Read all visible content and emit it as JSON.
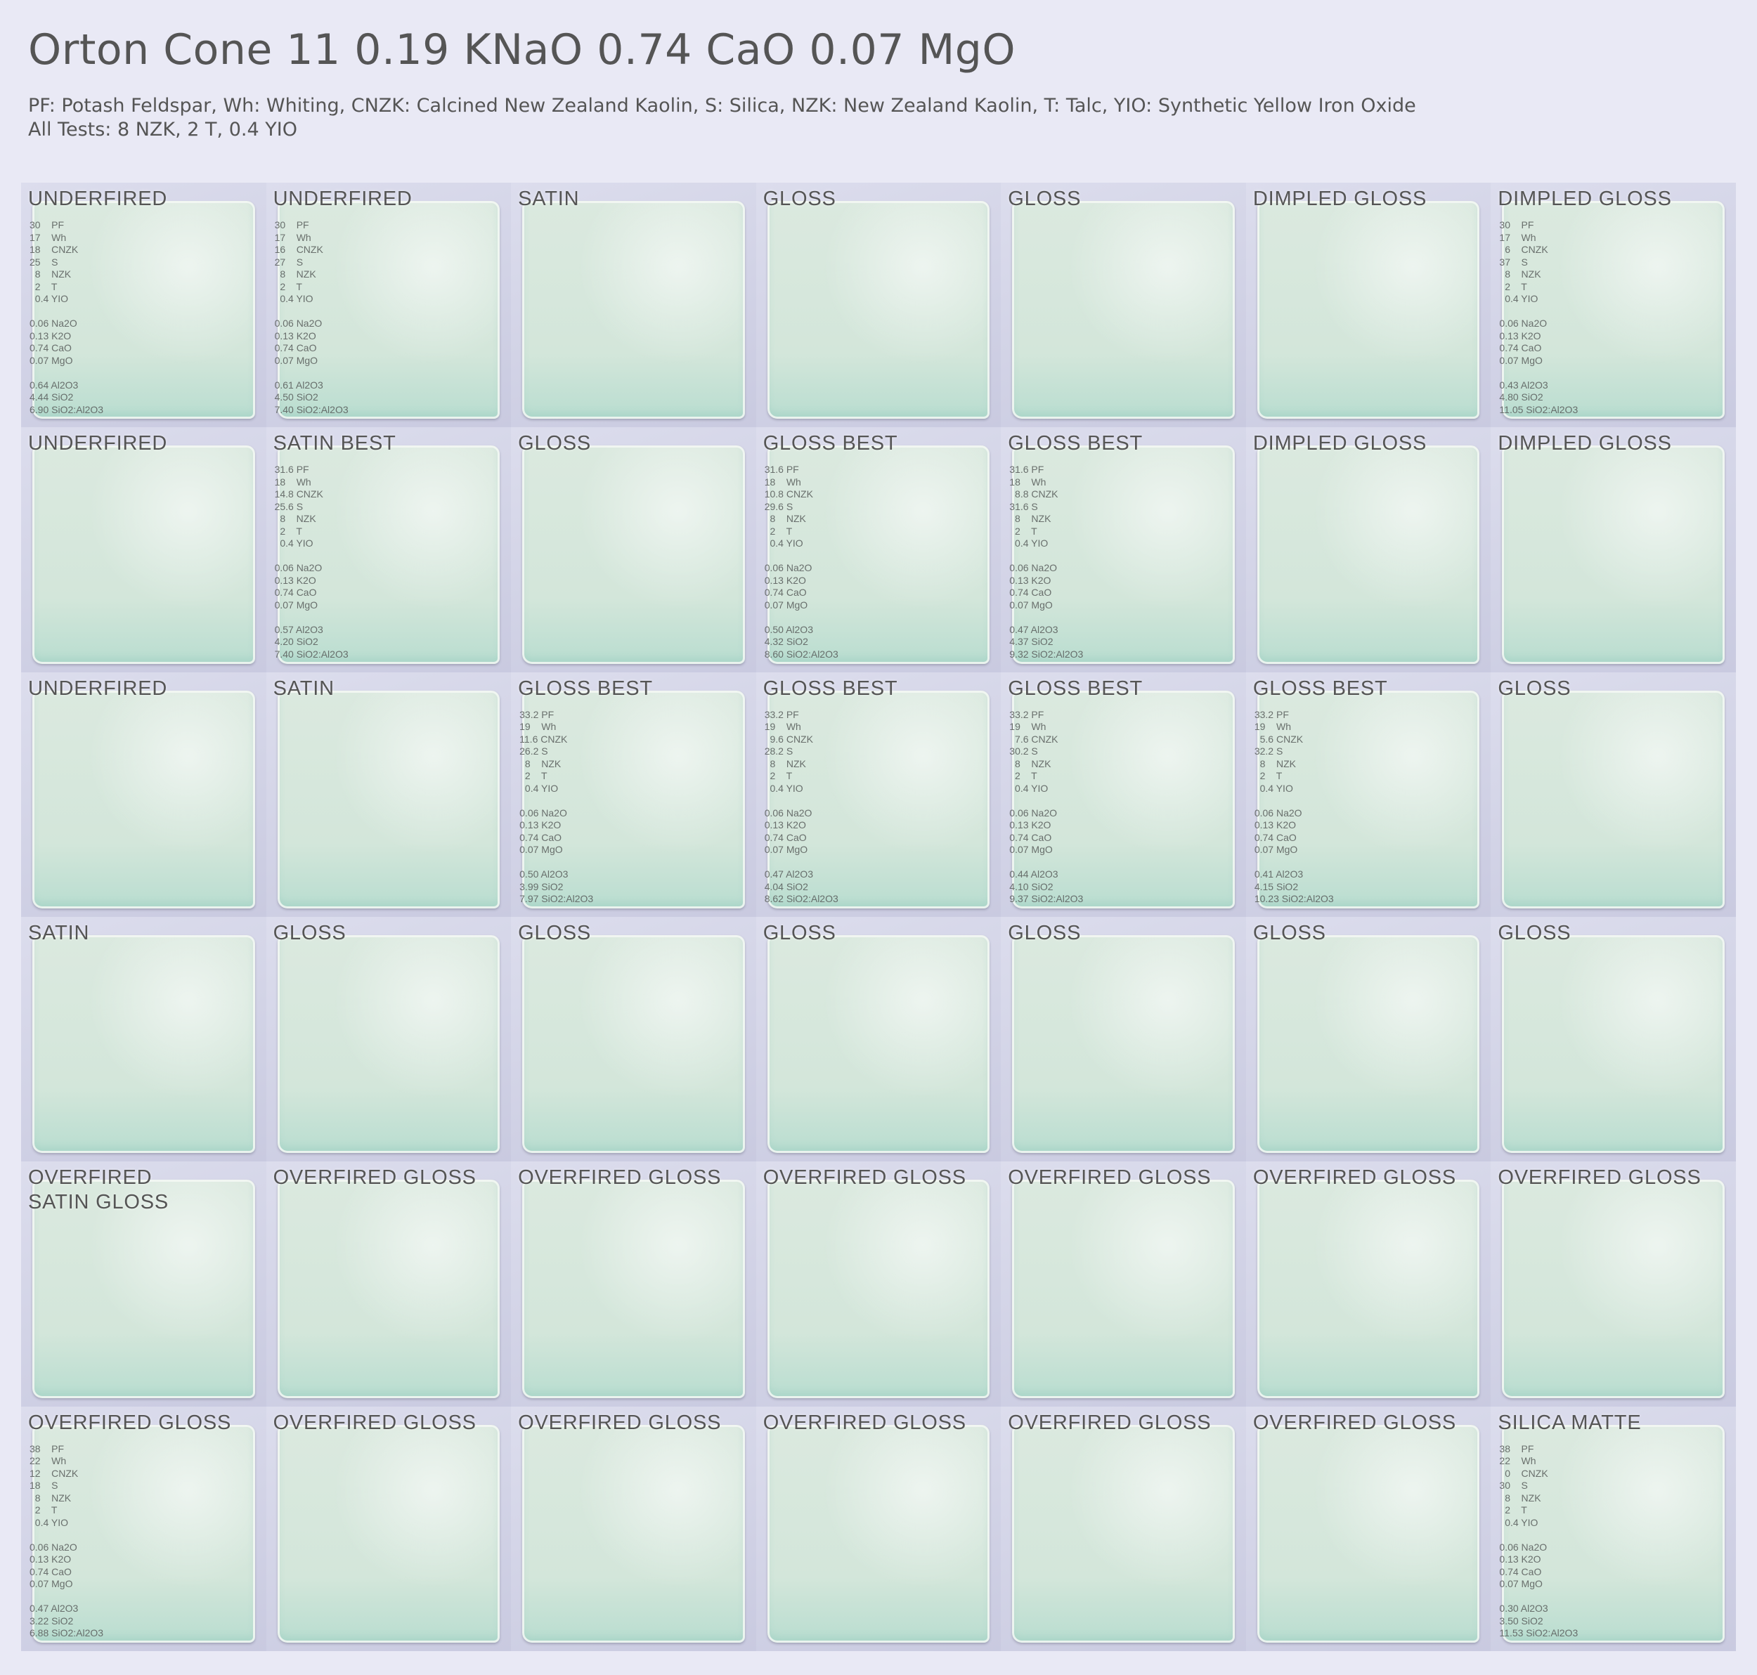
{
  "title": "Orton Cone 11 0.19 KNaO 0.74 CaO 0.07 MgO",
  "legend": "PF: Potash Feldspar, Wh: Whiting, CNZK: Calcined New Zealand Kaolin, S: Silica, NZK: New Zealand Kaolin, T: Talc, YIO: Synthetic Yellow Iron Oxide",
  "all_tests": "All Tests: 8 NZK, 2 T, 0.4 YIO",
  "tiles": [
    {
      "label": "UNDERFIRED",
      "recipe": "30    PF\n17    Wh\n18    CNZK\n25    S\n  8    NZK\n  2    T\n  0.4 YIO\n\n0.06 Na2O\n0.13 K2O\n0.74 CaO\n0.07 MgO\n\n0.64 Al2O3\n4.44 SiO2\n6.90 SiO2:Al2O3"
    },
    {
      "label": "UNDERFIRED",
      "recipe": "30    PF\n17    Wh\n16    CNZK\n27    S\n  8    NZK\n  2    T\n  0.4 YIO\n\n0.06 Na2O\n0.13 K2O\n0.74 CaO\n0.07 MgO\n\n0.61 Al2O3\n4.50 SiO2\n7.40 SiO2:Al2O3"
    },
    {
      "label": "SATIN",
      "recipe": ""
    },
    {
      "label": "GLOSS",
      "recipe": ""
    },
    {
      "label": "GLOSS",
      "recipe": ""
    },
    {
      "label": "DIMPLED GLOSS",
      "recipe": ""
    },
    {
      "label": "DIMPLED GLOSS",
      "recipe": "30    PF\n17    Wh\n  6    CNZK\n37    S\n  8    NZK\n  2    T\n  0.4 YIO\n\n0.06 Na2O\n0.13 K2O\n0.74 CaO\n0.07 MgO\n\n0.43 Al2O3\n4.80 SiO2\n11.05 SiO2:Al2O3"
    },
    {
      "label": "UNDERFIRED",
      "recipe": ""
    },
    {
      "label": "SATIN BEST",
      "recipe": "31.6 PF\n18    Wh\n14.8 CNZK\n25.6 S\n  8    NZK\n  2    T\n  0.4 YIO\n\n0.06 Na2O\n0.13 K2O\n0.74 CaO\n0.07 MgO\n\n0.57 Al2O3\n4.20 SiO2\n7.40 SiO2:Al2O3"
    },
    {
      "label": "GLOSS",
      "recipe": ""
    },
    {
      "label": "GLOSS BEST",
      "recipe": "31.6 PF\n18    Wh\n10.8 CNZK\n29.6 S\n  8    NZK\n  2    T\n  0.4 YIO\n\n0.06 Na2O\n0.13 K2O\n0.74 CaO\n0.07 MgO\n\n0.50 Al2O3\n4.32 SiO2\n8.60 SiO2:Al2O3"
    },
    {
      "label": "GLOSS BEST",
      "recipe": "31.6 PF\n18    Wh\n  8.8 CNZK\n31.6 S\n  8    NZK\n  2    T\n  0.4 YIO\n\n0.06 Na2O\n0.13 K2O\n0.74 CaO\n0.07 MgO\n\n0.47 Al2O3\n4.37 SiO2\n9.32 SiO2:Al2O3"
    },
    {
      "label": "DIMPLED GLOSS",
      "recipe": ""
    },
    {
      "label": "DIMPLED GLOSS",
      "recipe": ""
    },
    {
      "label": "UNDERFIRED",
      "recipe": ""
    },
    {
      "label": "SATIN",
      "recipe": ""
    },
    {
      "label": "GLOSS BEST",
      "recipe": "33.2 PF\n19    Wh\n11.6 CNZK\n26.2 S\n  8    NZK\n  2    T\n  0.4 YIO\n\n0.06 Na2O\n0.13 K2O\n0.74 CaO\n0.07 MgO\n\n0.50 Al2O3\n3.99 SiO2\n7.97 SiO2:Al2O3"
    },
    {
      "label": "GLOSS BEST",
      "recipe": "33.2 PF\n19    Wh\n  9.6 CNZK\n28.2 S\n  8    NZK\n  2    T\n  0.4 YIO\n\n0.06 Na2O\n0.13 K2O\n0.74 CaO\n0.07 MgO\n\n0.47 Al2O3\n4.04 SiO2\n8.62 SiO2:Al2O3"
    },
    {
      "label": "GLOSS BEST",
      "recipe": "33.2 PF\n19    Wh\n  7.6 CNZK\n30.2 S\n  8    NZK\n  2    T\n  0.4 YIO\n\n0.06 Na2O\n0.13 K2O\n0.74 CaO\n0.07 MgO\n\n0.44 Al2O3\n4.10 SiO2\n9.37 SiO2:Al2O3"
    },
    {
      "label": "GLOSS BEST",
      "recipe": "33.2 PF\n19    Wh\n  5.6 CNZK\n32.2 S\n  8    NZK\n  2    T\n  0.4 YIO\n\n0.06 Na2O\n0.13 K2O\n0.74 CaO\n0.07 MgO\n\n0.41 Al2O3\n4.15 SiO2\n10.23 SiO2:Al2O3"
    },
    {
      "label": "GLOSS",
      "recipe": ""
    },
    {
      "label": "SATIN",
      "recipe": ""
    },
    {
      "label": "GLOSS",
      "recipe": ""
    },
    {
      "label": "GLOSS",
      "recipe": ""
    },
    {
      "label": "GLOSS",
      "recipe": ""
    },
    {
      "label": "GLOSS",
      "recipe": ""
    },
    {
      "label": "GLOSS",
      "recipe": ""
    },
    {
      "label": "GLOSS",
      "recipe": ""
    },
    {
      "label": "OVERFIRED\nSATIN GLOSS",
      "recipe": ""
    },
    {
      "label": "OVERFIRED GLOSS",
      "recipe": ""
    },
    {
      "label": "OVERFIRED GLOSS",
      "recipe": ""
    },
    {
      "label": "OVERFIRED GLOSS",
      "recipe": ""
    },
    {
      "label": "OVERFIRED GLOSS",
      "recipe": ""
    },
    {
      "label": "OVERFIRED GLOSS",
      "recipe": ""
    },
    {
      "label": "OVERFIRED GLOSS",
      "recipe": ""
    },
    {
      "label": "OVERFIRED GLOSS",
      "recipe": "38    PF\n22    Wh\n12    CNZK\n18    S\n  8    NZK\n  2    T\n  0.4 YIO\n\n0.06 Na2O\n0.13 K2O\n0.74 CaO\n0.07 MgO\n\n0.47 Al2O3\n3.22 SiO2\n6.88 SiO2:Al2O3"
    },
    {
      "label": "OVERFIRED GLOSS",
      "recipe": ""
    },
    {
      "label": "OVERFIRED GLOSS",
      "recipe": ""
    },
    {
      "label": "OVERFIRED GLOSS",
      "recipe": ""
    },
    {
      "label": "OVERFIRED GLOSS",
      "recipe": ""
    },
    {
      "label": "OVERFIRED GLOSS",
      "recipe": ""
    },
    {
      "label": "SILICA MATTE",
      "recipe": "38    PF\n22    Wh\n  0    CNZK\n30    S\n  8    NZK\n  2    T\n  0.4 YIO\n\n0.06 Na2O\n0.13 K2O\n0.74 CaO\n0.07 MgO\n\n0.30 Al2O3\n3.50 SiO2\n11.53 SiO2:Al2O3"
    }
  ]
}
